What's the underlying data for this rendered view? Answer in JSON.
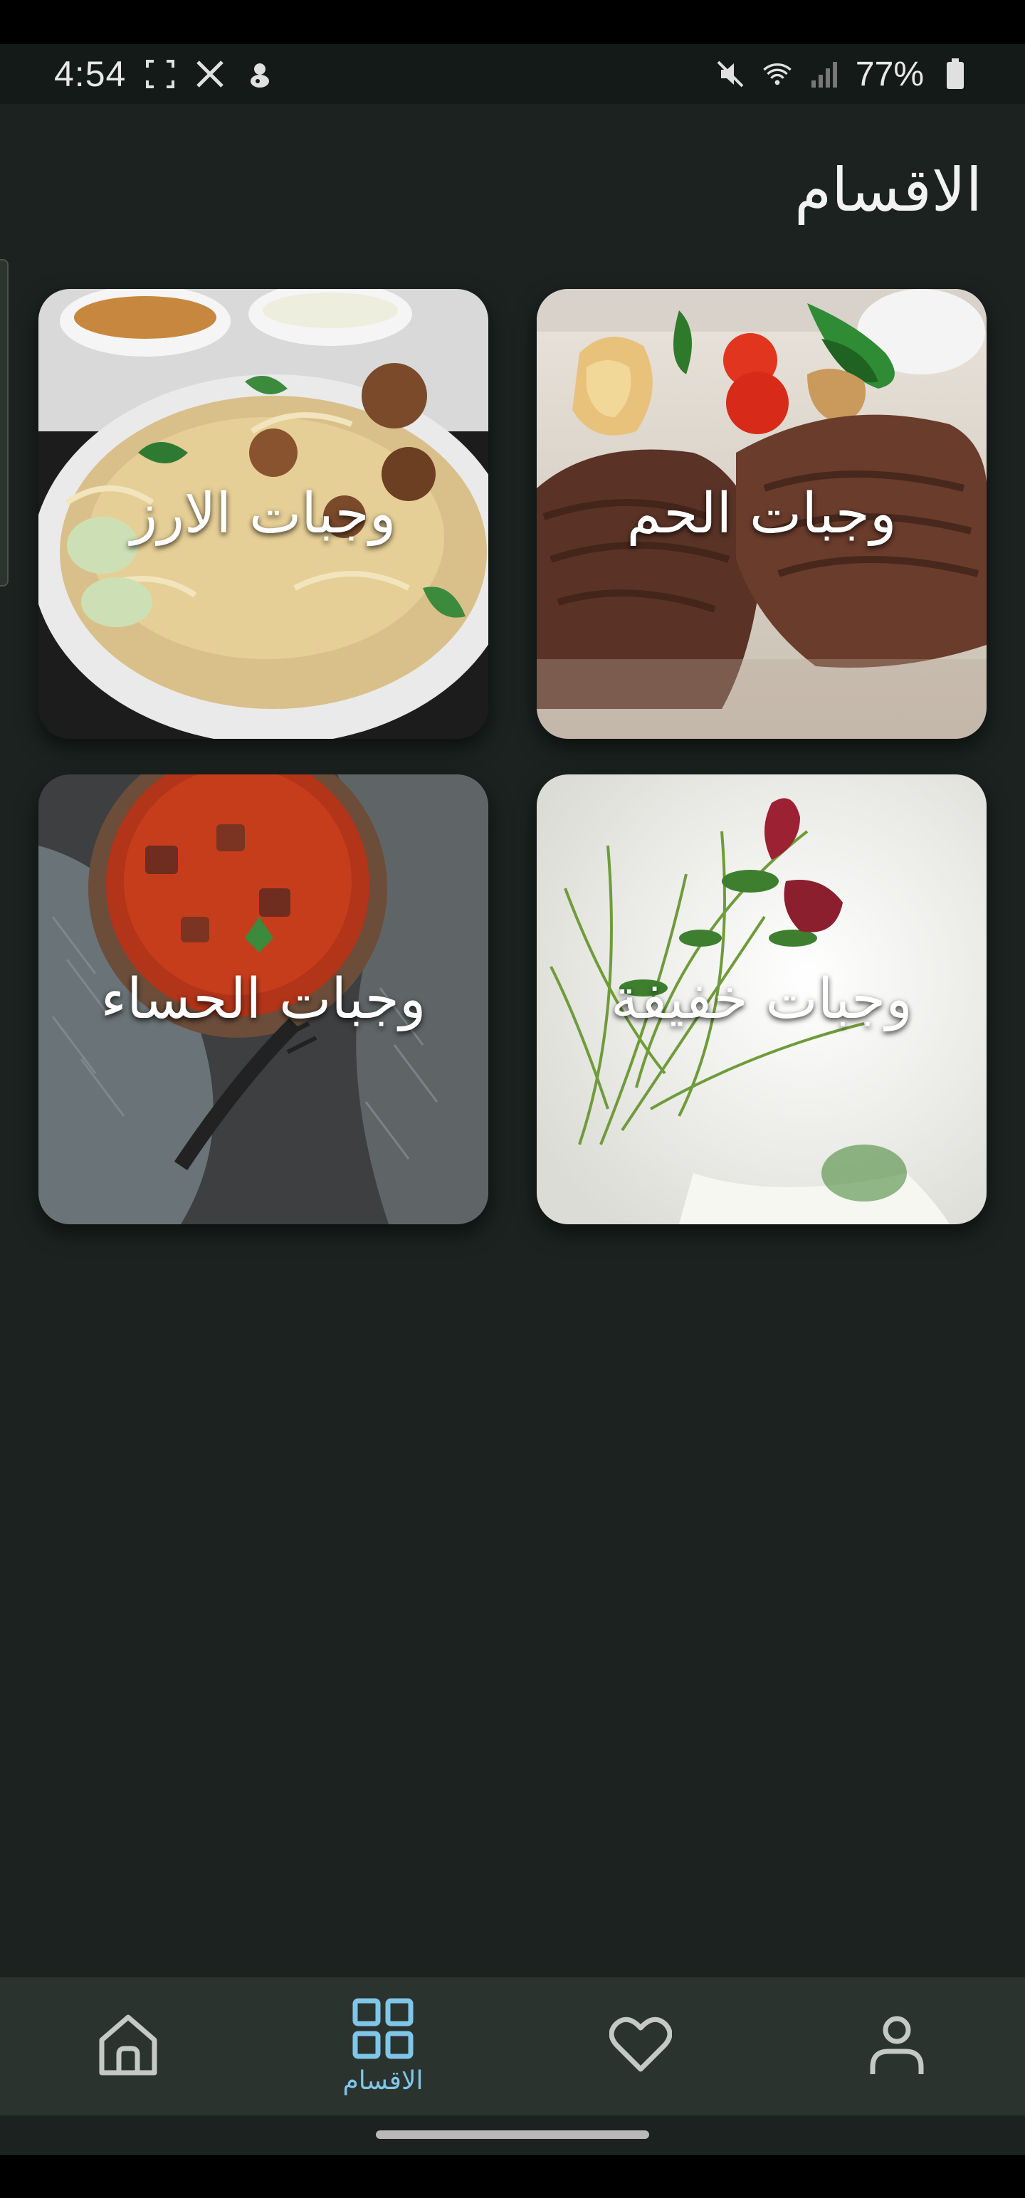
{
  "status_bar": {
    "time": "4:54",
    "left_icons": [
      "screenshot-frame-icon",
      "x-app-icon",
      "notification-app-icon"
    ],
    "right_icons": [
      "mute-icon",
      "wifi-icon",
      "signal-icon",
      "battery-icon"
    ],
    "battery_text": "77%"
  },
  "page": {
    "title": "الاقسام"
  },
  "categories": [
    {
      "label": "وجبات الحم",
      "image": "grilled-meat-photo"
    },
    {
      "label": "وجبات الارز",
      "image": "biryani-rice-photo"
    },
    {
      "label": "وجبات خفيفة",
      "image": "light-salad-photo"
    },
    {
      "label": "وجبات الحساء",
      "image": "soup-bowl-photo"
    }
  ],
  "bottom_nav": {
    "items": [
      {
        "icon": "person-icon",
        "label": ""
      },
      {
        "icon": "heart-icon",
        "label": ""
      },
      {
        "icon": "grid-icon",
        "label": "الاقسام",
        "active": true
      },
      {
        "icon": "home-icon",
        "label": ""
      }
    ],
    "active_color": "#7fc6e8",
    "inactive_color": "#c4c9c6"
  },
  "colors": {
    "background": "#1b221f",
    "nav_background": "#2b332f"
  }
}
